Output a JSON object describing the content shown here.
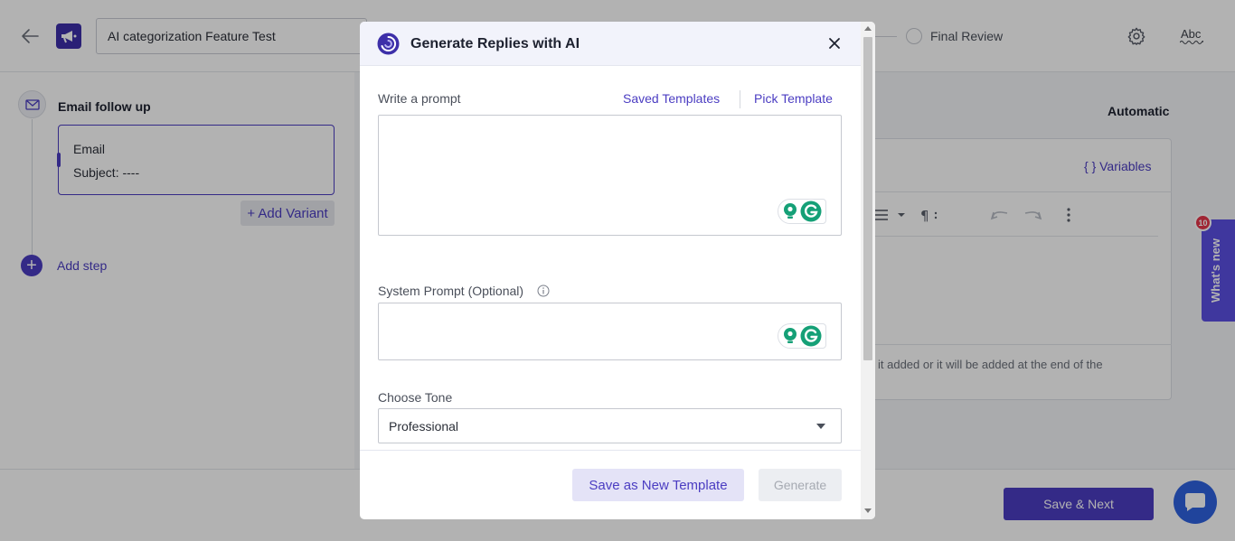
{
  "topbar": {
    "campaign_title": "AI categorization Feature Test",
    "stepper_label": "Final Review",
    "spellcheck_label": "Abc"
  },
  "sequence": {
    "step_title": "Email follow up",
    "variant_type": "Email",
    "variant_subject": "Subject: ----",
    "add_variant_label": "+ Add Variant",
    "add_step_label": "Add step"
  },
  "editor": {
    "mode_label": "Automatic",
    "variables_label": "{ } Variables",
    "footnote": "it added or it will be added at the end of the"
  },
  "bottombar": {
    "save_next_label": "Save & Next"
  },
  "whats_new": {
    "label": "What's new",
    "badge_count": "10"
  },
  "modal": {
    "title": "Generate Replies with AI",
    "prompt_label": "Write a prompt",
    "saved_templates_label": "Saved Templates",
    "pick_template_label": "Pick Template",
    "prompt_value": "",
    "system_prompt_label": "System Prompt (Optional)",
    "system_prompt_value": "",
    "tone_label": "Choose Tone",
    "tone_value": "Professional",
    "save_template_label": "Save as New Template",
    "generate_label": "Generate"
  },
  "colors": {
    "brand": "#4b3dc2",
    "whats_new_bg": "#5b4fe3",
    "chat_fab": "#2f62e0",
    "badge": "#e5364b",
    "grammarly": "#15a077"
  }
}
